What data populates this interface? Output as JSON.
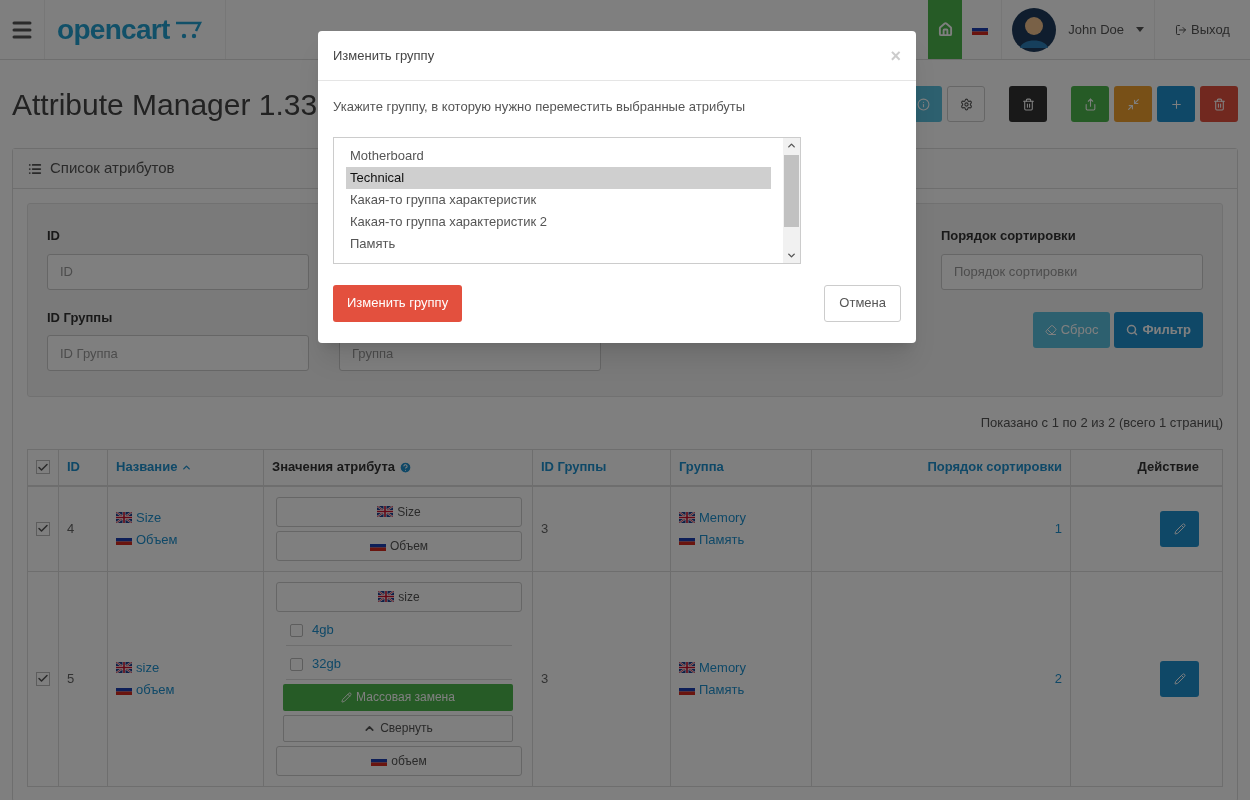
{
  "header": {
    "logo": "opencart",
    "user": "John Doe",
    "logout": "Выход"
  },
  "page_title": "Attribute Manager 1.33",
  "toolbar": [
    {
      "kind": "info"
    },
    {
      "kind": "settings"
    },
    {
      "kind": "dark-delete"
    },
    {
      "kind": "share"
    },
    {
      "kind": "compress"
    },
    {
      "kind": "add"
    },
    {
      "kind": "delete"
    }
  ],
  "panel": {
    "title": "Список атрибутов",
    "filter": {
      "row_1": [
        {
          "label": "ID",
          "placeholder": "ID"
        },
        {
          "label": "Порядок сортировки",
          "placeholder": "Порядок сортировки"
        }
      ],
      "row_2": [
        {
          "label": "ID Группы",
          "placeholder": "ID Группа"
        },
        {
          "placeholder": "Группа"
        }
      ],
      "reset": "Сброс",
      "submit": "Фильтр"
    },
    "summary": "Показано с 1 по 2 из 2 (всего 1 страниц)",
    "table": {
      "all_checked": true,
      "columns": [
        {
          "label": "ID",
          "link": true
        },
        {
          "label": "Название",
          "link": true,
          "sorted": true
        },
        {
          "label": "Значения атрибута",
          "link": false,
          "help": true
        },
        {
          "label": "ID Группы",
          "link": true
        },
        {
          "label": "Группа",
          "link": true
        },
        {
          "label": "Порядок сортировки",
          "link": true
        },
        {
          "label": "Действие",
          "link": false
        }
      ],
      "rows": [
        {
          "checked": true,
          "id": "4",
          "names": [
            {
              "kind": "en",
              "text": "Size"
            },
            {
              "kind": "ru",
              "text": "Объем"
            }
          ],
          "values": [
            {
              "kind": "value-en",
              "text": "Size"
            },
            {
              "kind": "value-ru",
              "text": "Объем"
            }
          ],
          "group_id": "3",
          "groups": [
            {
              "kind": "en",
              "text": "Memory"
            },
            {
              "kind": "ru",
              "text": "Память"
            }
          ],
          "sort_order": "1"
        },
        {
          "checked": true,
          "id": "5",
          "names": [
            {
              "kind": "en",
              "text": "size"
            },
            {
              "kind": "ru",
              "text": "объем"
            }
          ],
          "values": [
            {
              "kind": "value-en",
              "text": "size"
            },
            {
              "kind": "option",
              "text": "4gb",
              "checked": false
            },
            {
              "kind": "option",
              "text": "32gb",
              "checked": false
            },
            {
              "kind": "bulk",
              "text": "Массовая замена"
            },
            {
              "kind": "collapse",
              "text": "Свернуть"
            },
            {
              "kind": "value-ru",
              "text": "объем"
            }
          ],
          "group_id": "3",
          "groups": [
            {
              "kind": "en",
              "text": "Memory"
            },
            {
              "kind": "ru",
              "text": "Память"
            }
          ],
          "sort_order": "2"
        }
      ]
    }
  },
  "modal": {
    "title": "Изменить группу",
    "close": "×",
    "prompt": "Укажите группу, в которую нужно переместить выбранные атрибуты",
    "options": [
      {
        "label": "Motherboard",
        "selected": false
      },
      {
        "label": "Technical",
        "selected": true
      },
      {
        "label": "Какая-то группа характеристик",
        "selected": false
      },
      {
        "label": "Какая-то группа характеристик 2",
        "selected": false
      },
      {
        "label": "Память",
        "selected": false
      }
    ],
    "submit": "Изменить группу",
    "cancel": "Отмена"
  }
}
